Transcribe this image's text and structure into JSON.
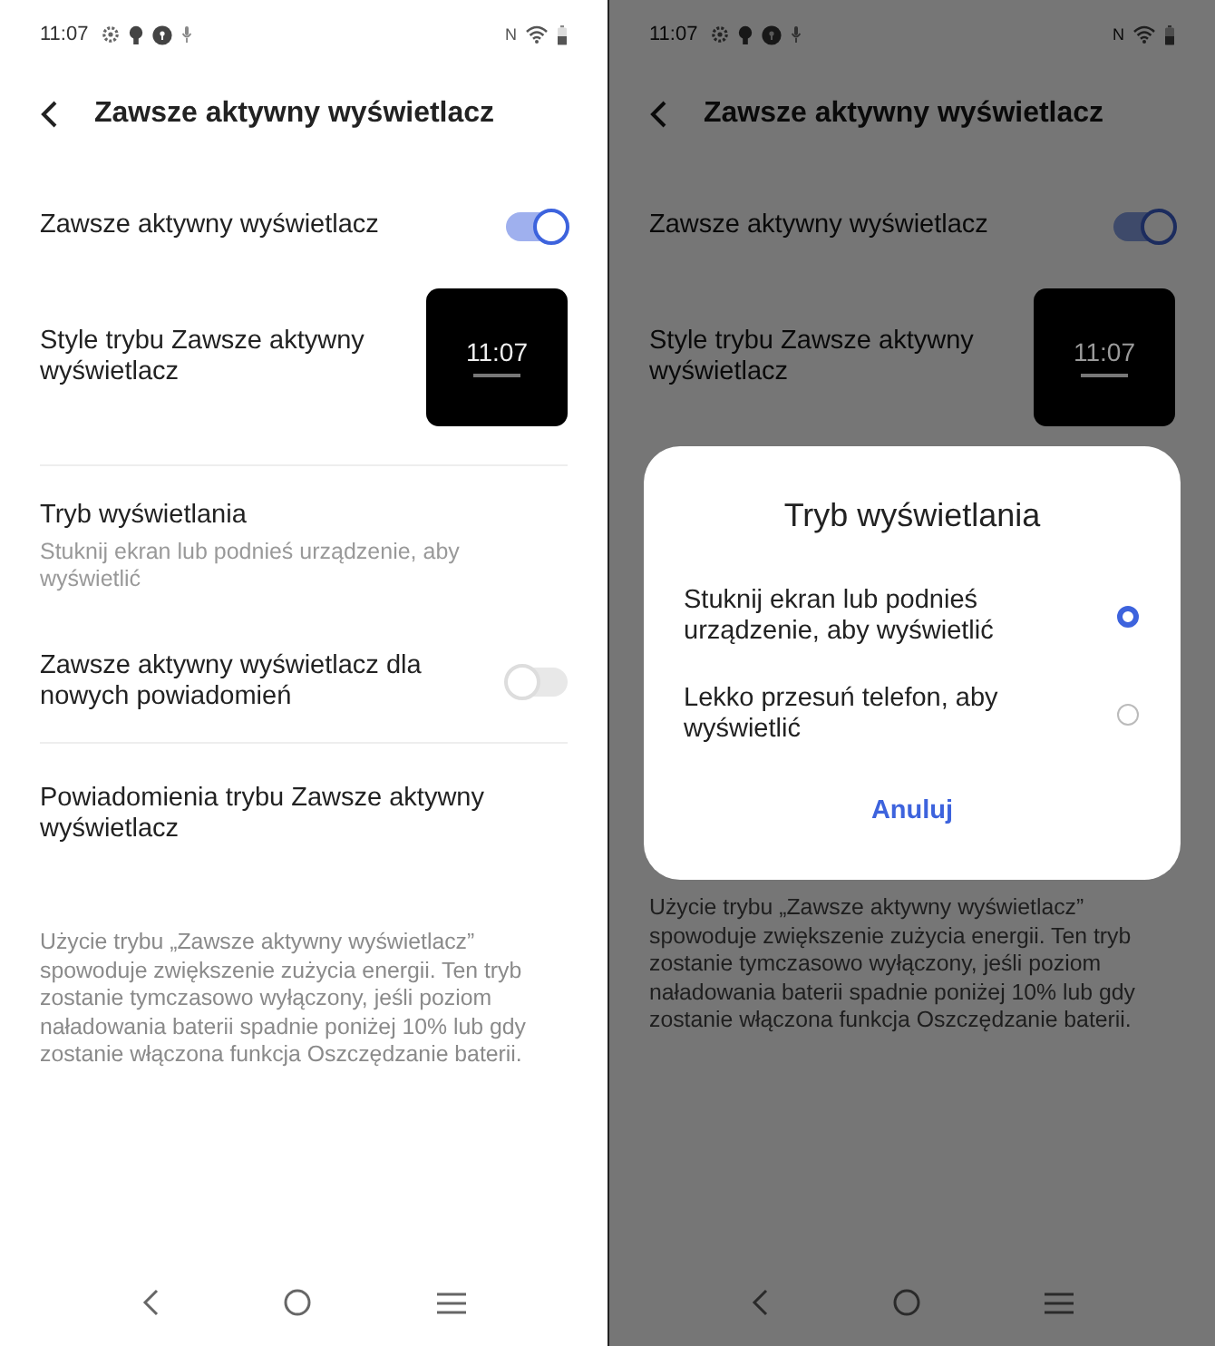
{
  "screens": [
    {
      "status_bar": {
        "time": "11:07",
        "nfc": "N"
      },
      "header": {
        "title": "Zawsze aktywny wyświetlacz"
      },
      "settings": [
        {
          "kind": "toggle",
          "title": "Zawsze aktywny wyświetlacz",
          "on": true
        },
        {
          "kind": "preview",
          "title": "Style trybu Zawsze aktywny wyświetlacz",
          "preview_time": "11:07"
        },
        {
          "kind": "divider"
        },
        {
          "kind": "option",
          "title": "Tryb wyświetlania",
          "subtitle": "Stuknij ekran lub podnieś urządzenie, aby wyświetlić"
        },
        {
          "kind": "toggle",
          "title": "Zawsze aktywny wyświetlacz dla nowych powiadomień",
          "on": false
        },
        {
          "kind": "divider"
        },
        {
          "kind": "link",
          "title": "Powiadomienia trybu Zawsze aktywny wyświetlacz"
        }
      ],
      "footnote": "Użycie trybu „Zawsze aktywny wyświetlacz” spowoduje zwiększenie zużycia energii. Ten tryb zostanie tymczasowo wyłączony, jeśli poziom naładowania baterii spadnie poniżej 10% lub gdy zostanie włączona funkcja Oszczędzanie baterii."
    },
    {
      "status_bar": {
        "time": "11:07",
        "nfc": "N"
      },
      "header": {
        "title": "Zawsze aktywny wyświetlacz"
      },
      "settings": [
        {
          "kind": "toggle",
          "title": "Zawsze aktywny wyświetlacz",
          "on": true
        },
        {
          "kind": "preview",
          "title": "Style trybu Zawsze aktywny wyświetlacz",
          "preview_time": "11:07"
        }
      ],
      "dialog": {
        "title": "Tryb wyświetlania",
        "options": [
          {
            "label": "Stuknij ekran lub podnieś urządzenie, aby wyświetlić",
            "selected": true
          },
          {
            "label": "Lekko przesuń telefon, aby wyświetlić",
            "selected": false
          }
        ],
        "cancel": "Anuluj"
      },
      "footnote": "Użycie trybu „Zawsze aktywny wyświetlacz” spowoduje zwiększenie zużycia energii. Ten tryb zostanie tymczasowo wyłączony, jeśli poziom naładowania baterii spadnie poniżej 10% lub gdy zostanie włączona funkcja Oszczędzanie baterii."
    }
  ]
}
